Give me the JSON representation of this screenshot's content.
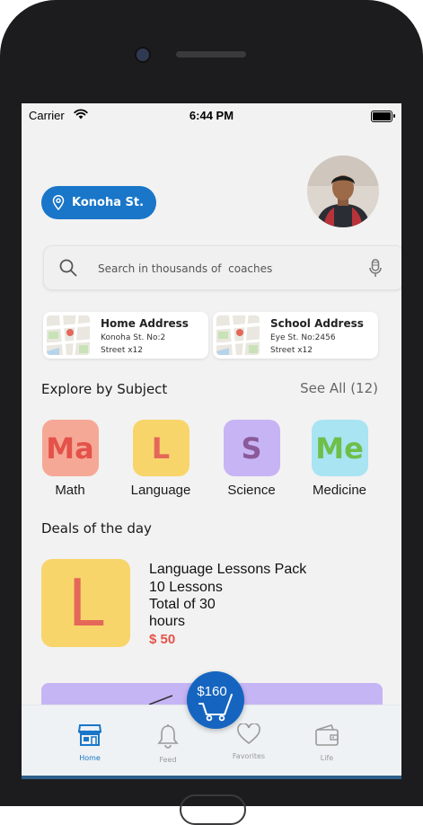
{
  "status_bar": {
    "carrier": "Carrier",
    "time": "6:44 PM"
  },
  "location": {
    "label": "Konoha St."
  },
  "search": {
    "placeholder": "Search in thousands of  coaches"
  },
  "addresses": [
    {
      "title": "Home Address",
      "line1": "Konoha St. No:2",
      "line2": "Street x12"
    },
    {
      "title": "School Address",
      "line1": "Eye St. No:2456",
      "line2": "Street x12"
    }
  ],
  "explore": {
    "title": "Explore by Subject",
    "see_all": "See All (12)"
  },
  "subjects": [
    {
      "abbr": "Ma",
      "label": "Math",
      "bg": "#f6a896",
      "fg": "#e4524a"
    },
    {
      "abbr": "L",
      "label": "Language",
      "bg": "#f8d56b",
      "fg": "#e4685a"
    },
    {
      "abbr": "S",
      "label": "Science",
      "bg": "#c7b4f5",
      "fg": "#8a5a9a"
    },
    {
      "abbr": "Me",
      "label": "Medicine",
      "bg": "#a9e4f2",
      "fg": "#6cc04a"
    }
  ],
  "deals": {
    "title": "Deals of the day",
    "item": {
      "tile_letter": "L",
      "name": "Language Lessons Pack",
      "lessons": "10 Lessons",
      "total_line1": "Total of 30",
      "total_line2": "hours",
      "price": "$ 50"
    }
  },
  "cart": {
    "amount": "$160"
  },
  "tabs": [
    {
      "label": "Home",
      "icon": "store-icon",
      "active": true
    },
    {
      "label": "Feed",
      "icon": "bell-icon",
      "active": false
    },
    {
      "label": "Favorites",
      "icon": "heart-icon",
      "active": false
    },
    {
      "label": "Life",
      "icon": "wallet-icon",
      "active": false
    }
  ],
  "colors": {
    "primary": "#1976c9",
    "price": "#e4524a",
    "promo": "#c6b5f5"
  }
}
